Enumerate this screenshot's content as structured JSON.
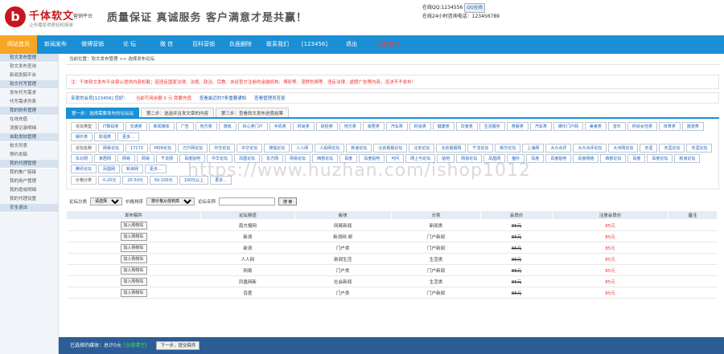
{
  "header": {
    "logo_glyph": "b",
    "logo_name": "千体软文",
    "logo_tag": "营销平台",
    "logo_sub": "让传播变得更轻松简单",
    "slogan": "质量保证 真诚服务 客户满意才是共赢！",
    "qq_text": "在线QQ:1234556",
    "qq_button": "QQ在线",
    "phone_text": "在线24小时咨询电话：123456789"
  },
  "nav": [
    "网站首页",
    "新闻发布",
    "微博营销",
    "论 坛",
    "微 信",
    "百科营销",
    "负面删除",
    "联系我们",
    "[123456]",
    "退出",
    "进度查询"
  ],
  "sidebar": [
    {
      "type": "head",
      "label": "软文发布管理"
    },
    {
      "type": "item",
      "label": "软文发布查询"
    },
    {
      "type": "item",
      "label": "新闻发稿平台"
    },
    {
      "type": "head",
      "label": "软文代写管理"
    },
    {
      "type": "item",
      "label": "发布代写需求"
    },
    {
      "type": "item",
      "label": "代写需求列表"
    },
    {
      "type": "head",
      "label": "我的财务管理"
    },
    {
      "type": "item",
      "label": "在线充值"
    },
    {
      "type": "item",
      "label": "消费记录明细"
    },
    {
      "type": "head",
      "label": "自助发帖管理"
    },
    {
      "type": "item",
      "label": "帖文列表"
    },
    {
      "type": "item",
      "label": "预约发稿"
    },
    {
      "type": "head",
      "label": "我的代理管理"
    },
    {
      "type": "item",
      "label": "我的推广链接"
    },
    {
      "type": "item",
      "label": "我的用户管理"
    },
    {
      "type": "item",
      "label": "我的提成明细"
    },
    {
      "type": "item",
      "label": "我的代理设置"
    },
    {
      "type": "head",
      "label": "安全退出"
    }
  ],
  "breadcrumb": "当前位置：软文发布管理 >> 选择发布论坛",
  "notice": "注：千体软文发布平台禁止提供内容松散；因违反国家法律、法规、政治、宗教、未经官方注册的金融机构、博彩等、淫秽色情等、违反法律、虚假广告等内容，否决不予发布！",
  "member": {
    "user": "亲爱的会员[123456] 您好：",
    "balance": "当前可用余额 0 元  我要充值",
    "link1": "查看最近的7条重要通知",
    "link2": "查看管理员答复"
  },
  "steps": [
    "第一步：选择需要发布的论坛站",
    "第二步：选选并且发文章的内容",
    "第三步：查看软文发布进度结果"
  ],
  "tag_rows": [
    {
      "lead": "论坛类型",
      "tags": [
        "IT数码类",
        "交通类",
        "新闻媒体",
        "广告",
        "地方类",
        "游戏",
        "好心类门户",
        "手机类",
        "时尚类",
        "财经类",
        "地方类",
        "家居类",
        "汽车类",
        "时尚类",
        "健康类",
        "饮食类",
        "生活服务",
        "育婴类",
        "汽车类",
        "娱乐门户网",
        "美食类",
        "音乐",
        "时尚女性类",
        "体育类",
        "旅游类",
        "娱乐类",
        "影视类",
        "更多..."
      ]
    },
    {
      "lead": "论坛名称",
      "tags": [
        "网易论坛",
        "17173",
        "MSN论坛",
        "万户网论坛",
        "中华论坛",
        "中华论坛",
        "搜狐论坛",
        "人人网",
        "人民网论坛",
        "新浪论坛",
        "北京晨报论坛",
        "北京论坛",
        "北京晨报网",
        "千龙论坛",
        "新华论坛",
        "上海网",
        "大众点评",
        "大众点评论坛",
        "大河网论坛",
        "天涯",
        "天涯论坛",
        "天涯论坛",
        "东北网",
        "家居网",
        "网易",
        "网易",
        "千龙网",
        "百度贴吧",
        "中华论坛",
        "凤凰论坛",
        "东方网",
        "网易论坛",
        "西部论坛",
        "百度",
        "百度贴吧",
        "可问",
        "网上与论坛",
        "贴吧",
        "网易论坛",
        "凤凰网",
        "猫扑",
        "百度",
        "百度贴吧",
        "百度网络",
        "西部论坛",
        "百度",
        "百度论坛",
        "新浪论坛",
        "腾讯论坛",
        "凤凰网",
        "新浪网",
        "更多..."
      ]
    },
    {
      "lead": "价格分类",
      "tags": [
        "0-20元",
        "20-50元",
        "50-100元",
        "100元以上",
        "更多..."
      ]
    }
  ],
  "filter": {
    "label1": "论坛分类",
    "select1": "请选择",
    "label2": "价格排序",
    "select2": "按价格从低到高",
    "label3": "论坛名称",
    "search_placeholder": "",
    "search_button": "搜 索"
  },
  "table": {
    "headers": [
      "发布稿件",
      "论坛频道",
      "板块",
      "分类",
      "会员价",
      "注册会员价",
      "备注"
    ],
    "rows": [
      {
        "btn": "加入购物车",
        "channel": "南方报网",
        "board": "网易新闻",
        "cat": "新闻类",
        "member": "85元",
        "reg": "85元"
      },
      {
        "btn": "加入购物车",
        "channel": "新浪",
        "board": "新浪网  频",
        "cat": "门户新闻",
        "member": "85元",
        "reg": "85元"
      },
      {
        "btn": "加入购物车",
        "channel": "新浪",
        "board": "门户类",
        "cat": "门户新闻",
        "member": "85元",
        "reg": "85元"
      },
      {
        "btn": "加入购物车",
        "channel": "人人网",
        "board": "新闻生活",
        "cat": "生活类",
        "member": "85元",
        "reg": "85元"
      },
      {
        "btn": "加入购物车",
        "channel": "网易",
        "board": "门户类",
        "cat": "门户新闻",
        "member": "85元",
        "reg": "85元"
      },
      {
        "btn": "加入购物车",
        "channel": "凤凰网新",
        "board": "社会新闻",
        "cat": "生活类",
        "member": "85元",
        "reg": "85元"
      },
      {
        "btn": "加入购物车",
        "channel": "百度",
        "board": "门户类",
        "cat": "门户新闻",
        "member": "85元",
        "reg": "85元"
      }
    ]
  },
  "bottom": {
    "text": "已选择的媒体：总计0元",
    "clear": "[全部清空]",
    "next": "下一步，提交稿件"
  },
  "watermark": "https://www.huzhan.com/ishop1012"
}
